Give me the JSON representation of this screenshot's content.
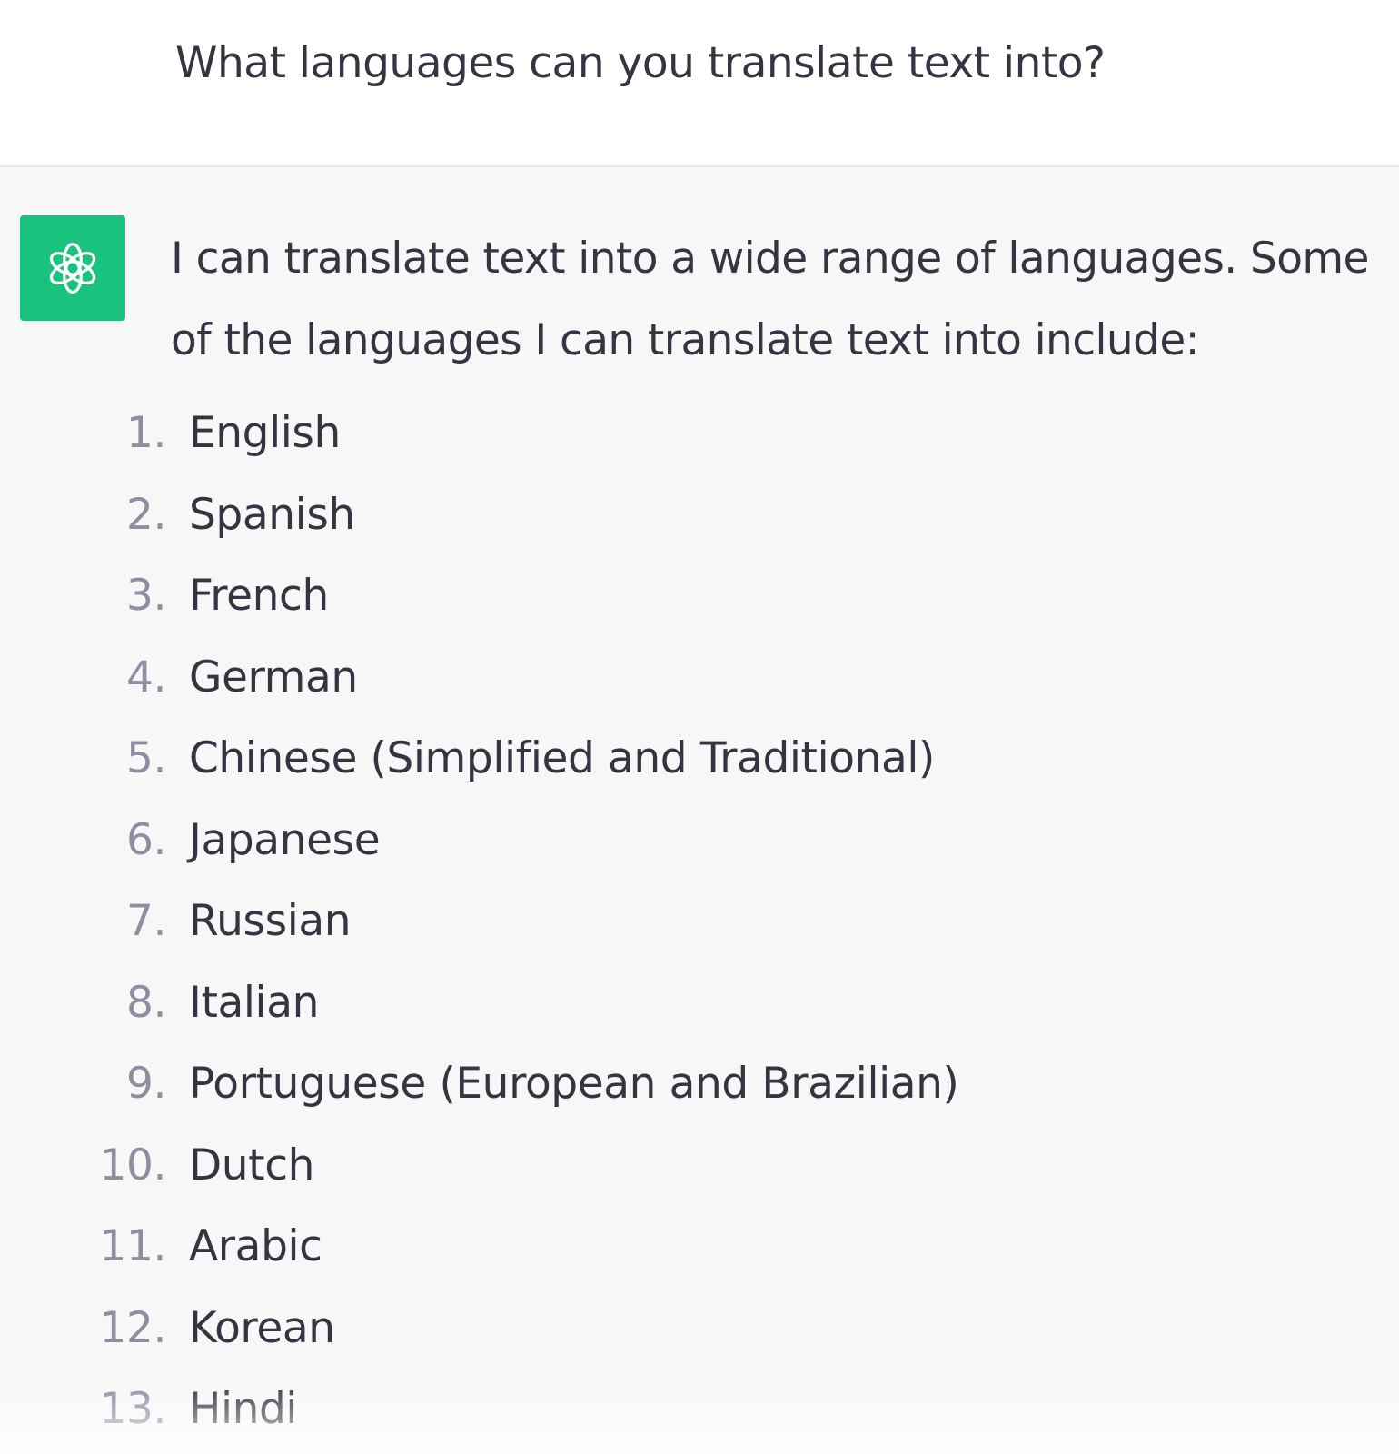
{
  "user_message": {
    "text": "What languages can you translate text into?"
  },
  "assistant_message": {
    "avatar_icon": "openai-logo-icon",
    "avatar_color": "#19c37d",
    "intro": "I can translate text into a wide range of languages. Some of the languages I can translate text into include:",
    "languages": [
      {
        "num": "1.",
        "name": "English"
      },
      {
        "num": "2.",
        "name": "Spanish"
      },
      {
        "num": "3.",
        "name": "French"
      },
      {
        "num": "4.",
        "name": "German"
      },
      {
        "num": "5.",
        "name": "Chinese (Simplified and Traditional)"
      },
      {
        "num": "6.",
        "name": "Japanese"
      },
      {
        "num": "7.",
        "name": "Russian"
      },
      {
        "num": "8.",
        "name": "Italian"
      },
      {
        "num": "9.",
        "name": "Portuguese (European and Brazilian)"
      },
      {
        "num": "10.",
        "name": "Dutch"
      },
      {
        "num": "11.",
        "name": "Arabic"
      },
      {
        "num": "12.",
        "name": "Korean"
      },
      {
        "num": "13.",
        "name": "Hindi"
      }
    ]
  },
  "colors": {
    "text": "#343541",
    "number": "#8e8ea0",
    "assistant_bg": "#f7f7f8",
    "user_bg": "#ffffff"
  }
}
